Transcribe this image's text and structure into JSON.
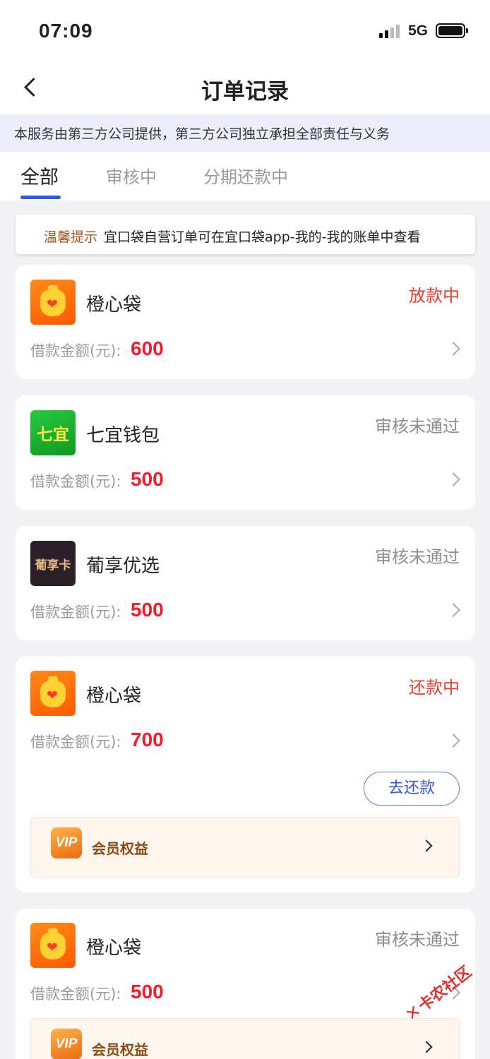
{
  "statusbar": {
    "time": "07:09",
    "network": "5G"
  },
  "navbar": {
    "title": "订单记录"
  },
  "notice": {
    "text": "本服务由第三方公司提供，第三方公司独立承担全部责任与义务"
  },
  "tabs": [
    {
      "label": "全部",
      "active": true
    },
    {
      "label": "审核中",
      "active": false
    },
    {
      "label": "分期还款中",
      "active": false
    }
  ],
  "tip": {
    "label": "温馨提示",
    "text": "宜口袋自营订单可在宜口袋app-我的-我的账单中查看"
  },
  "amount_label": "借款金额(元):",
  "orders": [
    {
      "name": "橙心袋",
      "logo": "orange-money-bag-icon",
      "status": "放款中",
      "status_color": "#f03a2e",
      "amount": "600"
    },
    {
      "name": "七宜钱包",
      "logo": "qiyi-wallet-logo",
      "logo_text": "七宜",
      "status": "审核未通过",
      "status_color": "#8e8e8e",
      "amount": "500"
    },
    {
      "name": "葡享优选",
      "logo": "puxiang-card-logo",
      "logo_text": "葡享卡",
      "status": "审核未通过",
      "status_color": "#8e8e8e",
      "amount": "500"
    },
    {
      "name": "橙心袋",
      "logo": "orange-money-bag-icon",
      "status": "还款中",
      "status_color": "#f03a2e",
      "amount": "700",
      "action": "去还款",
      "vip_label": "会员权益"
    },
    {
      "name": "橙心袋",
      "logo": "orange-money-bag-icon",
      "status": "审核未通过",
      "status_color": "#8e8e8e",
      "amount": "500",
      "vip_label": "会员权益"
    }
  ],
  "vip_icon_text": "VIP",
  "watermark": "卡农社区"
}
